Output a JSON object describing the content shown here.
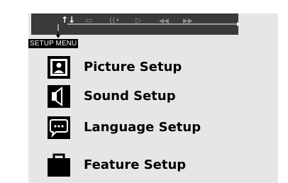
{
  "osd": {
    "toolbar_icons": [
      {
        "name": "setup-icon",
        "glyph": "↑↓",
        "active": true
      },
      {
        "name": "subtitle-icon",
        "glyph": "▭",
        "active": false
      },
      {
        "name": "audio-icon",
        "glyph": "((•",
        "active": false
      },
      {
        "name": "play-icon",
        "glyph": "▷",
        "active": false
      },
      {
        "name": "rewind-icon",
        "glyph": "◀◀",
        "active": false
      },
      {
        "name": "fast-forward-icon",
        "glyph": "▶▶",
        "active": false
      }
    ],
    "menu_title": "SETUP MENU",
    "items": [
      {
        "label": "Picture Setup",
        "icon": "picture-icon"
      },
      {
        "label": "Sound Setup",
        "icon": "speaker-icon"
      },
      {
        "label": "Language Setup",
        "icon": "speech-bubble-icon"
      },
      {
        "label": "Feature Setup",
        "icon": "briefcase-icon"
      }
    ]
  },
  "colors": {
    "panel_bg": "#e6e6e6",
    "toolbar_bg": "#3a3a3a",
    "label_bg": "#000000",
    "text": "#000000"
  }
}
